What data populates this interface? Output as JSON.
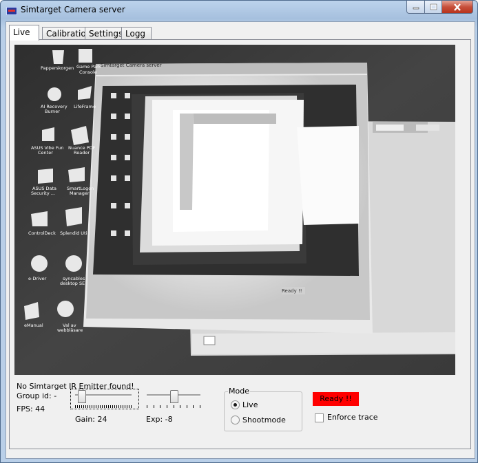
{
  "window": {
    "title": "Simtarget Camera server"
  },
  "tabs": [
    {
      "label": "Live",
      "active": true
    },
    {
      "label": "Calibration"
    },
    {
      "label": "Settings"
    },
    {
      "label": "Logg"
    }
  ],
  "live": {
    "emitter_status": "No Simtarget IR Emitter found!",
    "group_id": "Group id: -",
    "fps": "FPS: 44",
    "gain_label": "Gain: 24",
    "exp_label": "Exp: -8",
    "gain_level": 0.05,
    "exp_level": 0.5,
    "mode": {
      "title": "Mode",
      "options": [
        {
          "label": "Live",
          "checked": true
        },
        {
          "label": "Shootmode",
          "checked": false
        }
      ]
    },
    "status_button": "Ready !!",
    "status_color": "#ff0000",
    "enforce_trace_label": "Enforce trace",
    "enforce_trace_checked": false
  },
  "camera_preview": {
    "desktop_icons": [
      "Papperskorgen",
      "Game Park Console",
      "AI Recovery Burner",
      "LifeFrame",
      "ASUS Vibe Fun Center",
      "Nuance PDF Reader",
      "ASUS Data Security Manager",
      "SmartLogon Manager",
      "ControlDeck",
      "Splendid Utility",
      "e-Driver",
      "syncables desktop SE",
      "eManual",
      "Val av webbläsare"
    ],
    "nested_title": "Simtarget Camera server",
    "nested_ready": "Ready !!"
  }
}
